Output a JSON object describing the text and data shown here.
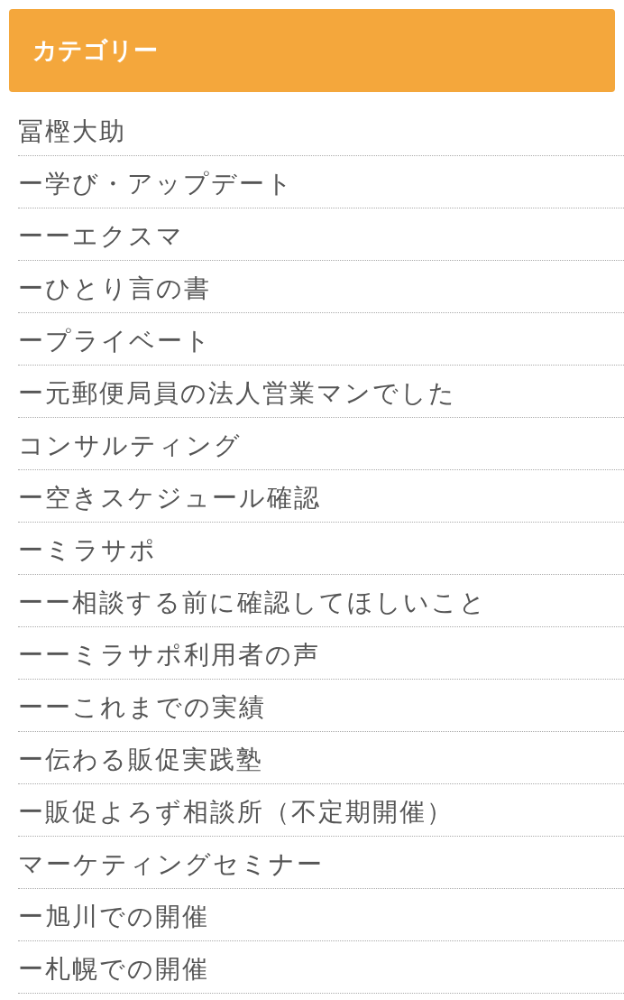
{
  "header": {
    "title": "カテゴリー"
  },
  "categories": [
    {
      "label": "冨樫大助"
    },
    {
      "label": "ー学び・アップデート"
    },
    {
      "label": "ーーエクスマ"
    },
    {
      "label": "ーひとり言の書"
    },
    {
      "label": "ープライベート"
    },
    {
      "label": "ー元郵便局員の法人営業マンでした"
    },
    {
      "label": "コンサルティング"
    },
    {
      "label": "ー空きスケジュール確認"
    },
    {
      "label": "ーミラサポ"
    },
    {
      "label": "ーー相談する前に確認してほしいこと"
    },
    {
      "label": "ーーミラサポ利用者の声"
    },
    {
      "label": "ーーこれまでの実績"
    },
    {
      "label": "ー伝わる販促実践塾"
    },
    {
      "label": "ー販促よろず相談所（不定期開催）"
    },
    {
      "label": "マーケティングセミナー"
    },
    {
      "label": "ー旭川での開催"
    },
    {
      "label": "ー札幌での開催"
    }
  ]
}
